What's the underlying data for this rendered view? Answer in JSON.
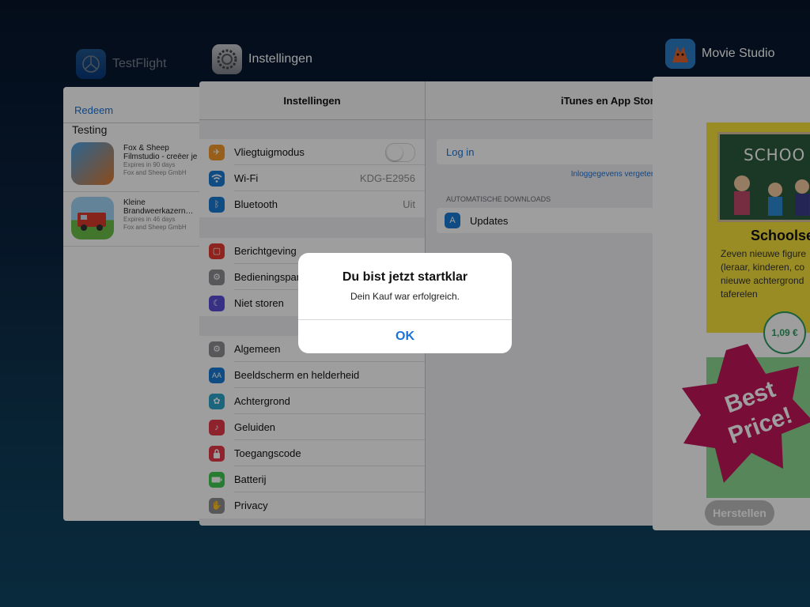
{
  "switcher": {
    "apps": [
      {
        "name": "TestFlight",
        "icon": "testflight-icon"
      },
      {
        "name": "Instellingen",
        "icon": "settings-gear-icon"
      },
      {
        "name": "Movie Studio",
        "icon": "movie-studio-fox-icon"
      }
    ]
  },
  "testflight": {
    "redeem": "Redeem",
    "section": "Testing",
    "apps": [
      {
        "title1": "Fox & Sheep",
        "title2": "Filmstudio - creëer je",
        "expires": "Expires in 90 days",
        "dev": "Fox and Sheep GmbH"
      },
      {
        "title1": "Kleine",
        "title2": "Brandweerkazern…",
        "expires": "Expires in 46 days",
        "dev": "Fox and Sheep GmbH"
      }
    ]
  },
  "settings": {
    "master_title": "Instellingen",
    "detail_title": "iTunes en App Store",
    "group1": [
      {
        "label": "Vliegtuigmodus",
        "icon": "airplane-icon",
        "color": "#f59a2b"
      },
      {
        "label": "Wi-Fi",
        "value": "KDG-E2956",
        "icon": "wifi-icon",
        "color": "#1a7bd6"
      },
      {
        "label": "Bluetooth",
        "value": "Uit",
        "icon": "bluetooth-icon",
        "color": "#1a7bd6"
      }
    ],
    "group2": [
      {
        "label": "Berichtgeving",
        "icon": "notifications-icon",
        "color": "#e53b30"
      },
      {
        "label": "Bedieningspaneel",
        "icon": "control-center-icon",
        "color": "#8e8e93"
      },
      {
        "label": "Niet storen",
        "icon": "moon-icon",
        "color": "#5b4ed6"
      }
    ],
    "group3": [
      {
        "label": "Algemeen",
        "icon": "general-gear-icon",
        "color": "#8e8e93"
      },
      {
        "label": "Beeldscherm en helderheid",
        "icon": "display-brightness-icon",
        "color": "#1a7bd6"
      },
      {
        "label": "Achtergrond",
        "icon": "wallpaper-icon",
        "color": "#2ca5c9"
      },
      {
        "label": "Geluiden",
        "icon": "sounds-icon",
        "color": "#e5384a"
      },
      {
        "label": "Toegangscode",
        "icon": "lock-icon",
        "color": "#e5384a"
      },
      {
        "label": "Batterij",
        "icon": "battery-icon",
        "color": "#3ec94f"
      },
      {
        "label": "Privacy",
        "icon": "hand-icon",
        "color": "#8e8e93"
      }
    ],
    "login": "Log in",
    "forgot": "Inloggegevens vergeten?",
    "auto_downloads": "AUTOMATISCHE DOWNLOADS",
    "updates": "Updates"
  },
  "movie_studio": {
    "board_text": "SCHOO L",
    "title": "Schoolse",
    "desc": "Zeven nieuwe figure (leraar, kinderen, co nieuwe achtergrond taferelen",
    "price": "1,09 €",
    "badge_line1": "Best",
    "badge_line2": "Price!",
    "restore": "Herstellen"
  },
  "alert": {
    "title": "Du bist jetzt startklar",
    "message": "Dein Kauf war erfolgreich.",
    "ok": "OK"
  }
}
